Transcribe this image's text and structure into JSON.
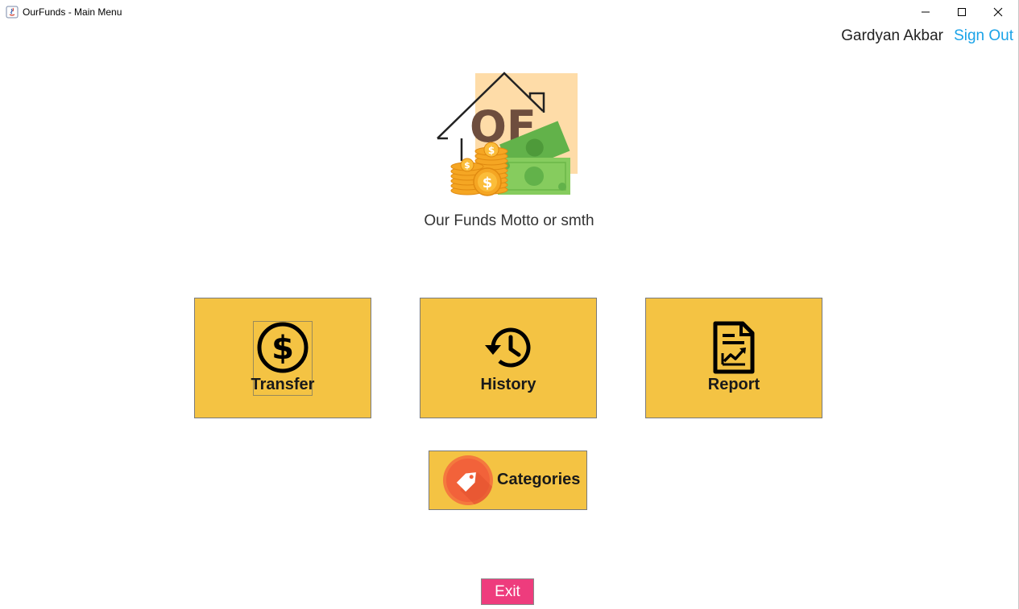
{
  "window": {
    "title": "OurFunds - Main Menu"
  },
  "user": {
    "name": "Gardyan Akbar",
    "sign_out_label": "Sign Out"
  },
  "brand": {
    "logo_text": "OF",
    "motto": "Our Funds Motto or smth"
  },
  "menu": {
    "transfer_label": "Transfer",
    "history_label": "History",
    "report_label": "Report",
    "categories_label": "Categories"
  },
  "footer": {
    "exit_label": "Exit"
  },
  "colors": {
    "tile": "#f4c343",
    "link": "#1aa3e8",
    "exit": "#ee3c7d",
    "tag": "#f26b3a"
  },
  "icons": {
    "transfer": "dollar-circle-icon",
    "history": "history-clock-icon",
    "report": "report-chart-icon",
    "categories": "tag-icon"
  }
}
